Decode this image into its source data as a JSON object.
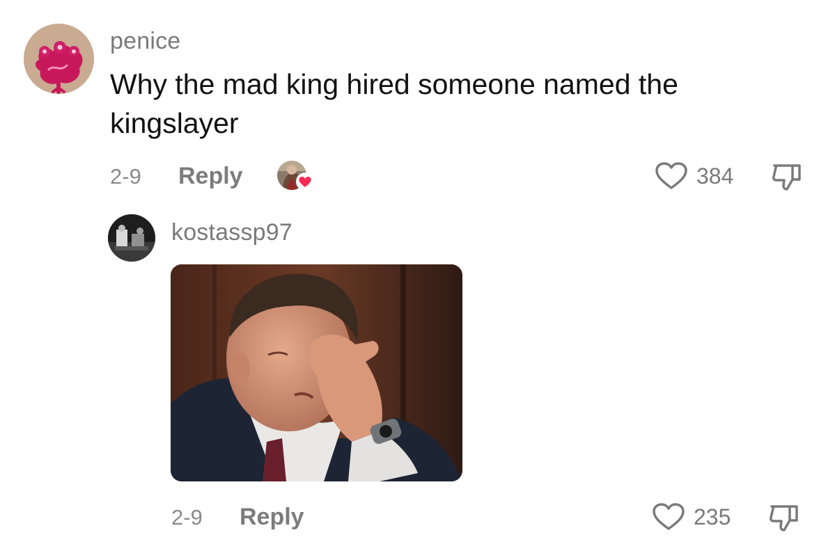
{
  "comment": {
    "username": "penice",
    "text_line1": "Why the mad king hired someone named the",
    "text_line2": "kingslayer",
    "date": "2-9",
    "reply_label": "Reply",
    "like_count": "384"
  },
  "reply": {
    "username": "kostassp97",
    "date": "2-9",
    "reply_label": "Reply",
    "like_count": "235"
  },
  "icons": {
    "like": "heart-outline-icon",
    "dislike": "thumbs-down-icon",
    "creator_liked": "creator-liked-heart-icon"
  },
  "colors": {
    "creator_heart": "#fe2c55",
    "muted_text": "#8a8a8a"
  }
}
